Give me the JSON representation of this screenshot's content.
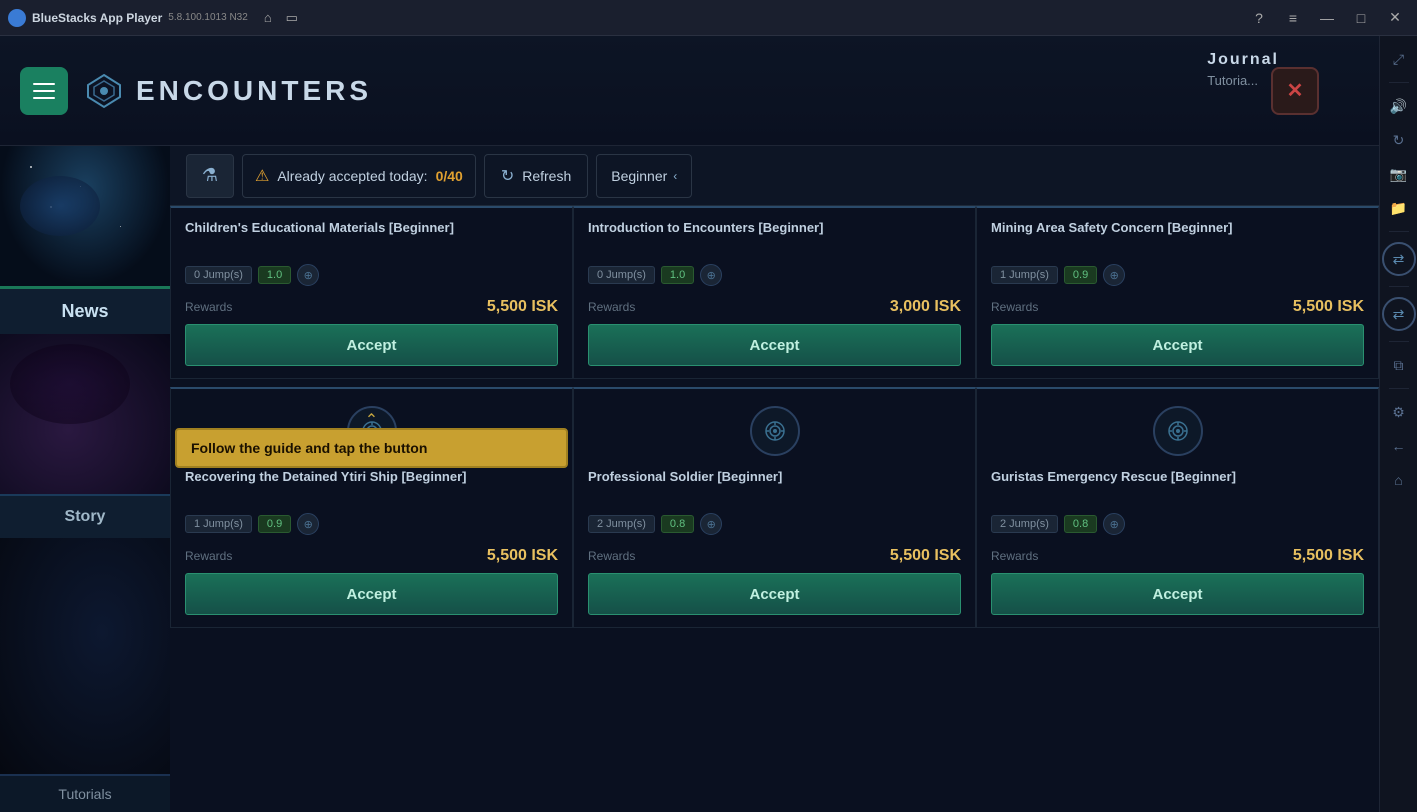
{
  "titlebar": {
    "app_name": "BlueStacks App Player",
    "version": "5.8.100.1013  N32",
    "min_label": "—",
    "max_label": "□",
    "close_label": "✕"
  },
  "header": {
    "logo_text": "ENCOUNTERS",
    "close_label": "✕",
    "journal_label": "Journal",
    "tutorial_label": "Tutoria..."
  },
  "filter_bar": {
    "filter_icon": "⚗",
    "warning_text": "Already accepted today:",
    "accepted_count": "0/40",
    "refresh_label": "Refresh",
    "difficulty_label": "Beginner"
  },
  "left_panel": {
    "news_label": "News",
    "story_label": "Story",
    "tutorials_label": "Tutorials"
  },
  "cards": [
    {
      "title": "Children's Educational Materials [Beginner]",
      "jumps": "0 Jump(s)",
      "security": "1.0",
      "rewards_label": "Rewards",
      "rewards_value": "5,500 ISK",
      "accept_label": "Accept",
      "has_tooltip": true,
      "tooltip_text": "Follow the guide and tap the button",
      "row": 0
    },
    {
      "title": "Introduction to Encounters [Beginner]",
      "jumps": "0 Jump(s)",
      "security": "1.0",
      "rewards_label": "Rewards",
      "rewards_value": "3,000 ISK",
      "accept_label": "Accept",
      "has_tooltip": false,
      "row": 0
    },
    {
      "title": "Mining Area Safety Concern [Beginner]",
      "jumps": "1 Jump(s)",
      "security": "0.9",
      "rewards_label": "Rewards",
      "rewards_value": "5,500 ISK",
      "accept_label": "Accept",
      "has_tooltip": false,
      "row": 0
    },
    {
      "title": "Recovering the Detained Ytiri Ship [Beginner]",
      "jumps": "1 Jump(s)",
      "security": "0.9",
      "rewards_label": "Rewards",
      "rewards_value": "5,500 ISK",
      "accept_label": "Accept",
      "has_tooltip": false,
      "row": 1
    },
    {
      "title": "Professional Soldier [Beginner]",
      "jumps": "2 Jump(s)",
      "security": "0.8",
      "rewards_label": "Rewards",
      "rewards_value": "5,500 ISK",
      "accept_label": "Accept",
      "has_tooltip": false,
      "row": 1
    },
    {
      "title": "Guristas Emergency Rescue [Beginner]",
      "jumps": "2 Jump(s)",
      "security": "0.8",
      "rewards_label": "Rewards",
      "rewards_value": "5,500 ISK",
      "accept_label": "Accept",
      "has_tooltip": false,
      "row": 1
    }
  ]
}
